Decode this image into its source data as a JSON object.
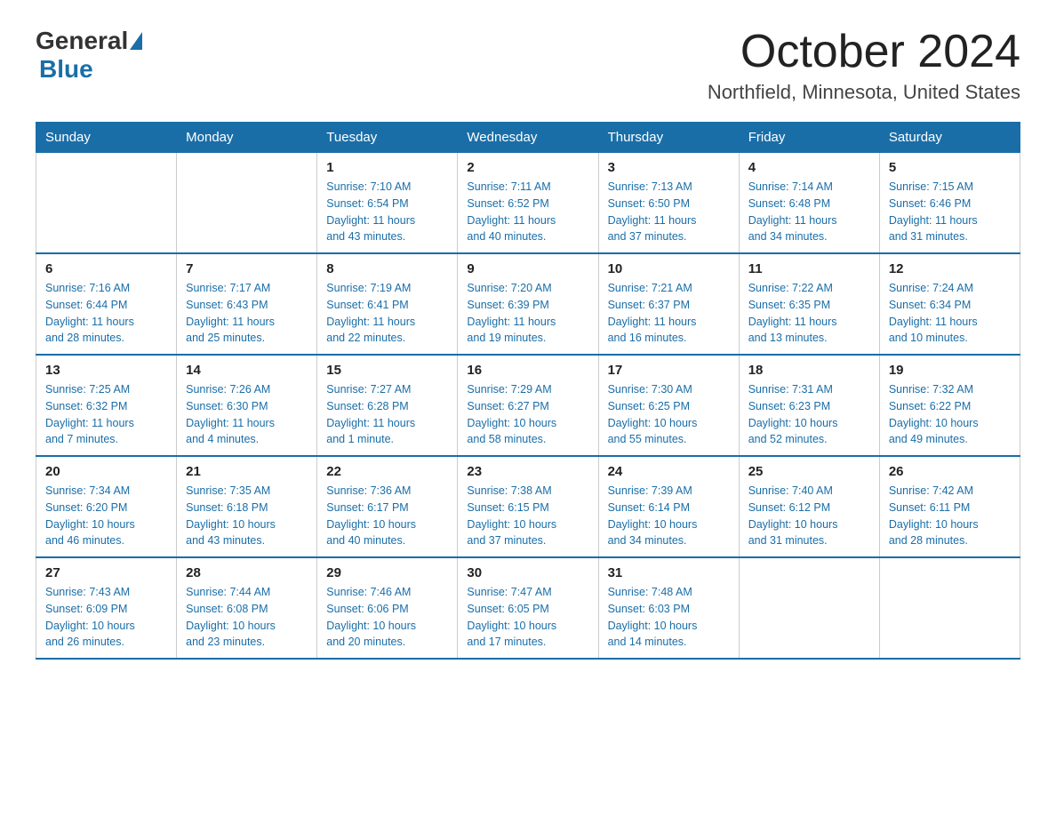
{
  "header": {
    "logo_general": "General",
    "logo_blue": "Blue",
    "month_title": "October 2024",
    "location": "Northfield, Minnesota, United States"
  },
  "days_of_week": [
    "Sunday",
    "Monday",
    "Tuesday",
    "Wednesday",
    "Thursday",
    "Friday",
    "Saturday"
  ],
  "weeks": [
    [
      {
        "day": "",
        "info": ""
      },
      {
        "day": "",
        "info": ""
      },
      {
        "day": "1",
        "info": "Sunrise: 7:10 AM\nSunset: 6:54 PM\nDaylight: 11 hours\nand 43 minutes."
      },
      {
        "day": "2",
        "info": "Sunrise: 7:11 AM\nSunset: 6:52 PM\nDaylight: 11 hours\nand 40 minutes."
      },
      {
        "day": "3",
        "info": "Sunrise: 7:13 AM\nSunset: 6:50 PM\nDaylight: 11 hours\nand 37 minutes."
      },
      {
        "day": "4",
        "info": "Sunrise: 7:14 AM\nSunset: 6:48 PM\nDaylight: 11 hours\nand 34 minutes."
      },
      {
        "day": "5",
        "info": "Sunrise: 7:15 AM\nSunset: 6:46 PM\nDaylight: 11 hours\nand 31 minutes."
      }
    ],
    [
      {
        "day": "6",
        "info": "Sunrise: 7:16 AM\nSunset: 6:44 PM\nDaylight: 11 hours\nand 28 minutes."
      },
      {
        "day": "7",
        "info": "Sunrise: 7:17 AM\nSunset: 6:43 PM\nDaylight: 11 hours\nand 25 minutes."
      },
      {
        "day": "8",
        "info": "Sunrise: 7:19 AM\nSunset: 6:41 PM\nDaylight: 11 hours\nand 22 minutes."
      },
      {
        "day": "9",
        "info": "Sunrise: 7:20 AM\nSunset: 6:39 PM\nDaylight: 11 hours\nand 19 minutes."
      },
      {
        "day": "10",
        "info": "Sunrise: 7:21 AM\nSunset: 6:37 PM\nDaylight: 11 hours\nand 16 minutes."
      },
      {
        "day": "11",
        "info": "Sunrise: 7:22 AM\nSunset: 6:35 PM\nDaylight: 11 hours\nand 13 minutes."
      },
      {
        "day": "12",
        "info": "Sunrise: 7:24 AM\nSunset: 6:34 PM\nDaylight: 11 hours\nand 10 minutes."
      }
    ],
    [
      {
        "day": "13",
        "info": "Sunrise: 7:25 AM\nSunset: 6:32 PM\nDaylight: 11 hours\nand 7 minutes."
      },
      {
        "day": "14",
        "info": "Sunrise: 7:26 AM\nSunset: 6:30 PM\nDaylight: 11 hours\nand 4 minutes."
      },
      {
        "day": "15",
        "info": "Sunrise: 7:27 AM\nSunset: 6:28 PM\nDaylight: 11 hours\nand 1 minute."
      },
      {
        "day": "16",
        "info": "Sunrise: 7:29 AM\nSunset: 6:27 PM\nDaylight: 10 hours\nand 58 minutes."
      },
      {
        "day": "17",
        "info": "Sunrise: 7:30 AM\nSunset: 6:25 PM\nDaylight: 10 hours\nand 55 minutes."
      },
      {
        "day": "18",
        "info": "Sunrise: 7:31 AM\nSunset: 6:23 PM\nDaylight: 10 hours\nand 52 minutes."
      },
      {
        "day": "19",
        "info": "Sunrise: 7:32 AM\nSunset: 6:22 PM\nDaylight: 10 hours\nand 49 minutes."
      }
    ],
    [
      {
        "day": "20",
        "info": "Sunrise: 7:34 AM\nSunset: 6:20 PM\nDaylight: 10 hours\nand 46 minutes."
      },
      {
        "day": "21",
        "info": "Sunrise: 7:35 AM\nSunset: 6:18 PM\nDaylight: 10 hours\nand 43 minutes."
      },
      {
        "day": "22",
        "info": "Sunrise: 7:36 AM\nSunset: 6:17 PM\nDaylight: 10 hours\nand 40 minutes."
      },
      {
        "day": "23",
        "info": "Sunrise: 7:38 AM\nSunset: 6:15 PM\nDaylight: 10 hours\nand 37 minutes."
      },
      {
        "day": "24",
        "info": "Sunrise: 7:39 AM\nSunset: 6:14 PM\nDaylight: 10 hours\nand 34 minutes."
      },
      {
        "day": "25",
        "info": "Sunrise: 7:40 AM\nSunset: 6:12 PM\nDaylight: 10 hours\nand 31 minutes."
      },
      {
        "day": "26",
        "info": "Sunrise: 7:42 AM\nSunset: 6:11 PM\nDaylight: 10 hours\nand 28 minutes."
      }
    ],
    [
      {
        "day": "27",
        "info": "Sunrise: 7:43 AM\nSunset: 6:09 PM\nDaylight: 10 hours\nand 26 minutes."
      },
      {
        "day": "28",
        "info": "Sunrise: 7:44 AM\nSunset: 6:08 PM\nDaylight: 10 hours\nand 23 minutes."
      },
      {
        "day": "29",
        "info": "Sunrise: 7:46 AM\nSunset: 6:06 PM\nDaylight: 10 hours\nand 20 minutes."
      },
      {
        "day": "30",
        "info": "Sunrise: 7:47 AM\nSunset: 6:05 PM\nDaylight: 10 hours\nand 17 minutes."
      },
      {
        "day": "31",
        "info": "Sunrise: 7:48 AM\nSunset: 6:03 PM\nDaylight: 10 hours\nand 14 minutes."
      },
      {
        "day": "",
        "info": ""
      },
      {
        "day": "",
        "info": ""
      }
    ]
  ]
}
